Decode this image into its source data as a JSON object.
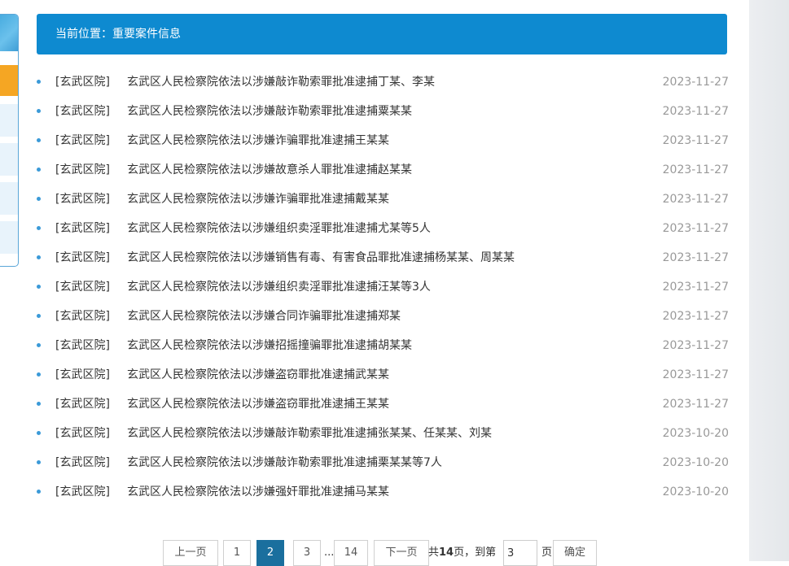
{
  "header": {
    "breadcrumb": "当前位置：重要案件信息"
  },
  "items": [
    {
      "source": "[玄武区院]",
      "title": "玄武区人民检察院依法以涉嫌敲诈勒索罪批准逮捕丁某、李某",
      "date": "2023-11-27"
    },
    {
      "source": "[玄武区院]",
      "title": "玄武区人民检察院依法以涉嫌敲诈勒索罪批准逮捕粟某某",
      "date": "2023-11-27"
    },
    {
      "source": "[玄武区院]",
      "title": "玄武区人民检察院依法以涉嫌诈骗罪批准逮捕王某某",
      "date": "2023-11-27"
    },
    {
      "source": "[玄武区院]",
      "title": "玄武区人民检察院依法以涉嫌故意杀人罪批准逮捕赵某某",
      "date": "2023-11-27"
    },
    {
      "source": "[玄武区院]",
      "title": "玄武区人民检察院依法以涉嫌诈骗罪批准逮捕戴某某",
      "date": "2023-11-27"
    },
    {
      "source": "[玄武区院]",
      "title": "玄武区人民检察院依法以涉嫌组织卖淫罪批准逮捕尤某等5人",
      "date": "2023-11-27"
    },
    {
      "source": "[玄武区院]",
      "title": "玄武区人民检察院依法以涉嫌销售有毒、有害食品罪批准逮捕杨某某、周某某",
      "date": "2023-11-27"
    },
    {
      "source": "[玄武区院]",
      "title": "玄武区人民检察院依法以涉嫌组织卖淫罪批准逮捕汪某等3人",
      "date": "2023-11-27"
    },
    {
      "source": "[玄武区院]",
      "title": "玄武区人民检察院依法以涉嫌合同诈骗罪批准逮捕郑某",
      "date": "2023-11-27"
    },
    {
      "source": "[玄武区院]",
      "title": "玄武区人民检察院依法以涉嫌招摇撞骗罪批准逮捕胡某某",
      "date": "2023-11-27"
    },
    {
      "source": "[玄武区院]",
      "title": "玄武区人民检察院依法以涉嫌盗窃罪批准逮捕武某某",
      "date": "2023-11-27"
    },
    {
      "source": "[玄武区院]",
      "title": "玄武区人民检察院依法以涉嫌盗窃罪批准逮捕王某某",
      "date": "2023-11-27"
    },
    {
      "source": "[玄武区院]",
      "title": "玄武区人民检察院依法以涉嫌敲诈勒索罪批准逮捕张某某、任某某、刘某",
      "date": "2023-10-20"
    },
    {
      "source": "[玄武区院]",
      "title": "玄武区人民检察院依法以涉嫌敲诈勒索罪批准逮捕栗某某等7人",
      "date": "2023-10-20"
    },
    {
      "source": "[玄武区院]",
      "title": "玄武区人民检察院依法以涉嫌强奸罪批准逮捕马某某",
      "date": "2023-10-20"
    }
  ],
  "pager": {
    "prev": "上一页",
    "pages": [
      "1",
      "2",
      "3"
    ],
    "current": "2",
    "ellipsis": "...",
    "last": "14",
    "next": "下一页",
    "total_prefix": "共",
    "total_pages": "14",
    "total_suffix": "页，到第",
    "goto_value": "3",
    "page_unit": "页",
    "confirm": "确定"
  },
  "colors": {
    "accent": "#0e8ad0",
    "active_page": "#1a6f9e",
    "bullet": "#3b9ad8",
    "highlight": "#f5a623"
  }
}
